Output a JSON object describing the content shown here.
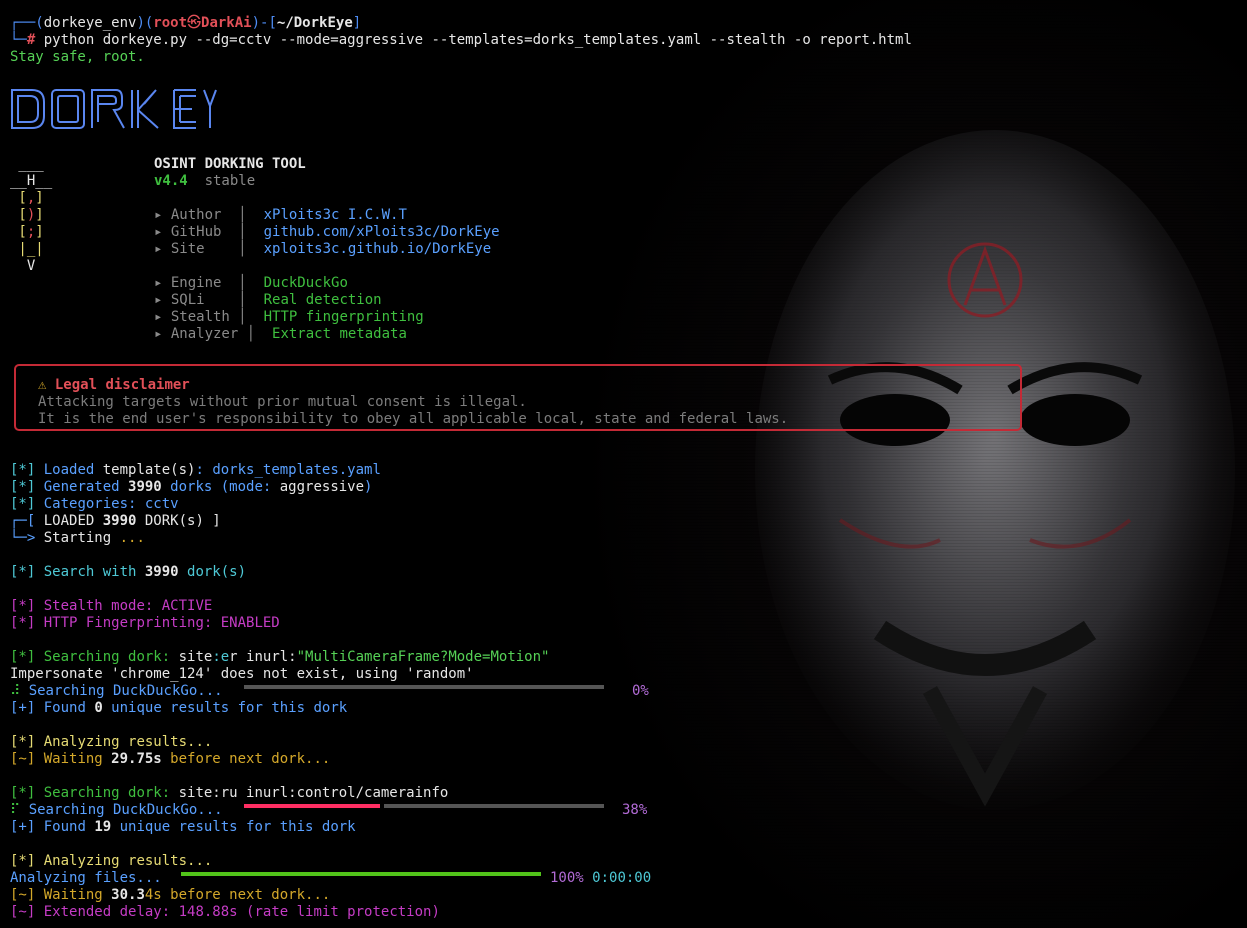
{
  "prompt": {
    "env": "dorkeye_env",
    "user": "root",
    "skull": "㉿",
    "host": "DarkAi",
    "path": "~/DorkEye",
    "hash": "#",
    "command": "python dorkeye.py --dg=cctv --mode=aggressive --templates=dorks_templates.yaml --stealth -o report.html"
  },
  "greeting": "Stay safe, root.",
  "logo": "DORK EYE",
  "mascot": [
    " ___",
    "__H__",
    " [,]",
    " [)]",
    " [;]",
    " |_|",
    "  V"
  ],
  "tool": {
    "title": "OSINT DORKING TOOL",
    "version": "v4.4",
    "channel": "stable"
  },
  "info": [
    {
      "key": "▸ Author  ",
      "sep": "│",
      "value": "xPloits3c I.C.W.T"
    },
    {
      "key": "▸ GitHub  ",
      "sep": "│",
      "value": "github.com/xPloits3c/DorkEye"
    },
    {
      "key": "▸ Site    ",
      "sep": "│",
      "value": "xploits3c.github.io/DorkEye"
    }
  ],
  "features": [
    {
      "key": "▸ Engine  ",
      "sep": "│",
      "value": "DuckDuckGo"
    },
    {
      "key": "▸ SQLi    ",
      "sep": "│",
      "value": "Real detection"
    },
    {
      "key": "▸ Stealth ",
      "sep": "│",
      "value": "HTTP fingerprinting"
    },
    {
      "key": "▸ Analyzer ",
      "sep": "│",
      "value": "Extract metadata"
    }
  ],
  "disclaimer": {
    "icon": "⚠",
    "title": "Legal disclaimer",
    "line1": "Attacking targets without prior mutual consent is illegal.",
    "line2": "It is the end user's responsibility to obey all applicable local, state and federal laws."
  },
  "log": {
    "loaded": {
      "tag": "[*]",
      "text": " Loaded ",
      "word": "template(s)",
      "colon": ": ",
      "file": "dorks_templates.yaml"
    },
    "generated": {
      "tag": "[*]",
      "text": " Generated ",
      "count": "3990",
      "mid": " dorks (mode: ",
      "mode": "aggressive",
      "end": ")"
    },
    "categories": {
      "tag": "[*]",
      "text": " Categories: ",
      "value": "cctv"
    },
    "box_top": "┌─[",
    "box_label": " LOADED ",
    "box_count": "3990",
    "box_end": " DORK(s) ]",
    "box_bottom": "└─>",
    "starting": " Starting",
    "dots": " ...",
    "search_with": {
      "tag": "[*]",
      "text": " Search with ",
      "count": "3990",
      "end": " dork(s)"
    },
    "stealth": {
      "tag": "[*]",
      "text": " Stealth mode: ACTIVE"
    },
    "http_fp": {
      "tag": "[*]",
      "text": " HTTP Fingerprinting: ENABLED"
    },
    "dork1": {
      "tag": "[*]",
      "label": " Searching dork: ",
      "a": "site",
      "b": ":e",
      "c": "r inurl:",
      "query": "\"MultiCameraFrame?Mode=Motion\""
    },
    "impersonate": "Impersonate 'chrome_124' does not exist, using 'random'",
    "progress1": {
      "spinner": "⠼",
      "label": " Searching DuckDuckGo...",
      "percent": "0%",
      "value": 0
    },
    "found1": {
      "tag": "[+]",
      "text": " Found ",
      "count": "0",
      "end": " unique results for this dork"
    },
    "analyzing1": {
      "tag": "[*]",
      "text": " Analyzing results..."
    },
    "waiting1": {
      "tag": "[~]",
      "text": " Waiting ",
      "num": "29.75s",
      "end": " before next dork..."
    },
    "dork2": {
      "tag": "[*]",
      "label": " Searching dork: ",
      "query": "site:ru inurl:control/camerainfo"
    },
    "progress2": {
      "spinner": "⠏",
      "label": " Searching DuckDuckGo...",
      "percent": "38%",
      "value": 38
    },
    "found2": {
      "tag": "[+]",
      "text": " Found ",
      "count": "19",
      "end": " unique results for this dork"
    },
    "analyzing2": {
      "tag": "[*]",
      "text": " Analyzing results..."
    },
    "analyzing_files": {
      "label": "Analyzing files...",
      "percent": "100%",
      "time": "0:00:00",
      "value": 100
    },
    "waiting2": {
      "tag": "[~]",
      "text": " Waiting ",
      "num": "30.3",
      "num2": "4s",
      "end": " before next dork..."
    },
    "extended": {
      "tag": "[~]",
      "text": " Extended delay: ",
      "num": "148.88s",
      "end": " (rate limit protection)"
    }
  },
  "colors": {
    "accent": "#4e8df5",
    "danger": "#c42a36",
    "success": "#3fbf3f",
    "progress_track": "#555555",
    "progress_fill": "#ff2e63",
    "done_fill": "#52c41a"
  }
}
